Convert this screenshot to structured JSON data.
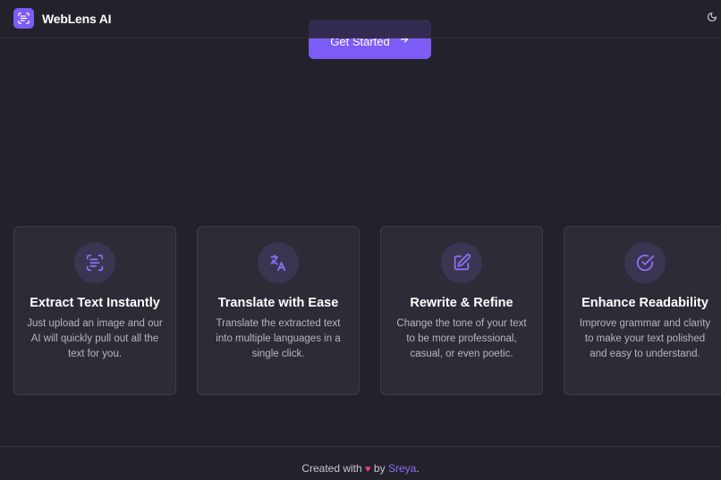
{
  "header": {
    "brand_name": "WebLens AI",
    "logo_icon": "scan-text-icon",
    "theme_icon": "moon-icon"
  },
  "hero": {
    "cta_label": "Get Started",
    "cta_icon": "arrow-right-icon"
  },
  "features": [
    {
      "icon": "scan-text-icon",
      "title": "Extract Text Instantly",
      "description": "Just upload an image and our AI will quickly pull out all the text for you."
    },
    {
      "icon": "languages-icon",
      "title": "Translate with Ease",
      "description": "Translate the extracted text into multiple languages in a single click."
    },
    {
      "icon": "pencil-square-icon",
      "title": "Rewrite & Refine",
      "description": "Change the tone of your text to be more professional, casual, or even poetic."
    },
    {
      "icon": "check-circle-icon",
      "title": "Enhance Readability",
      "description": "Improve grammar and clarity to make your text polished and easy to understand."
    }
  ],
  "footer": {
    "prefix": "Created with",
    "heart": "♥",
    "by": "by",
    "author": "Sreya",
    "suffix": "."
  },
  "colors": {
    "background": "#23212b",
    "accent": "#7c5cf5",
    "card": "#2d2b36",
    "heart": "#f0437a"
  }
}
